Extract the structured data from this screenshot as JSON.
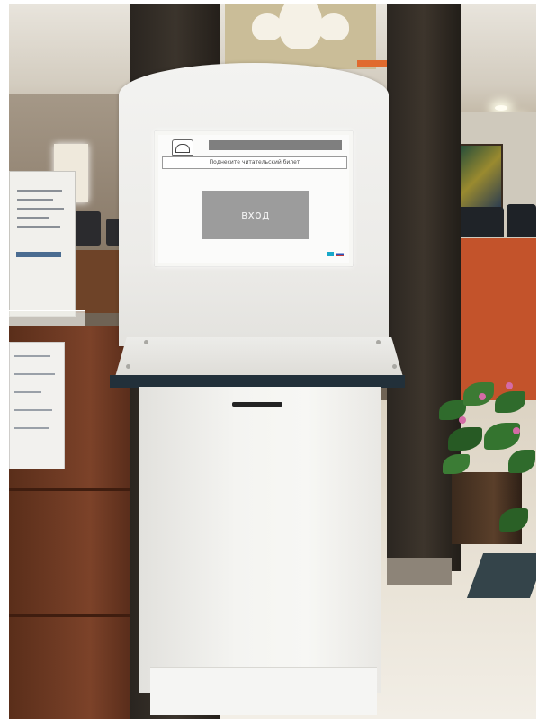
{
  "scene": {
    "subject": "kiosk",
    "screen": {
      "top_bar_text": "",
      "prompt": "Поднесите читательский билет",
      "login_button": "вход",
      "language_buttons": [
        "kz",
        "ru"
      ]
    },
    "brand_badge": "",
    "colors": {
      "screen_button": "#9c9c9c",
      "carpet": "#c3532b",
      "cabinet_wood": "#6e3a22",
      "kiosk_body": "#f3f3f1"
    }
  }
}
